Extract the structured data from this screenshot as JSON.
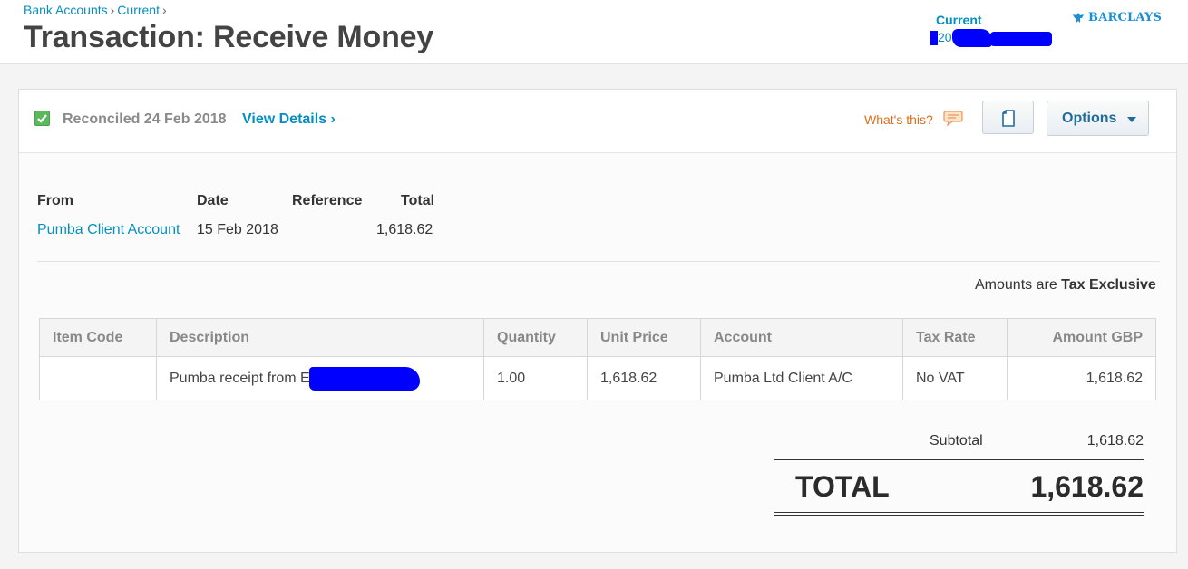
{
  "breadcrumb": {
    "items": [
      "Bank Accounts",
      "Current"
    ],
    "separator": "›"
  },
  "page": {
    "title": "Transaction: Receive Money"
  },
  "account": {
    "name": "Current",
    "number_visible": "20",
    "bank_name": "BARCLAYS",
    "bank_icon": "eagle-icon"
  },
  "status": {
    "icon": "checkbox-checked-icon",
    "text": "Reconciled 24 Feb 2018",
    "view_details": "View Details ›"
  },
  "help": {
    "label": "What's this?",
    "icon": "speech-bubble-icon"
  },
  "toolbar": {
    "copy_icon": "document-icon",
    "options_label": "Options",
    "options_icon": "caret-down-icon"
  },
  "summary": {
    "headers": {
      "from": "From",
      "date": "Date",
      "reference": "Reference",
      "total": "Total"
    },
    "values": {
      "from": "Pumba Client Account",
      "date": "15 Feb 2018",
      "reference": "",
      "total": "1,618.62"
    }
  },
  "tax_note": {
    "prefix": "Amounts are",
    "value": "Tax Exclusive"
  },
  "line_items": {
    "columns": [
      "Item Code",
      "Description",
      "Quantity",
      "Unit Price",
      "Account",
      "Tax Rate",
      "Amount GBP"
    ],
    "rows": [
      {
        "item_code": "",
        "description": "Pumba receipt from E",
        "quantity": "1.00",
        "unit_price": "1,618.62",
        "account": "Pumba Ltd Client A/C",
        "tax_rate": "No VAT",
        "amount": "1,618.62"
      }
    ]
  },
  "totals": {
    "subtotal_label": "Subtotal",
    "subtotal_value": "1,618.62",
    "total_label": "TOTAL",
    "total_value": "1,618.62"
  },
  "colors": {
    "link": "#048fc2",
    "accent_orange": "#e06c17",
    "success": "#5bb85d",
    "redaction": "#0000ff"
  }
}
